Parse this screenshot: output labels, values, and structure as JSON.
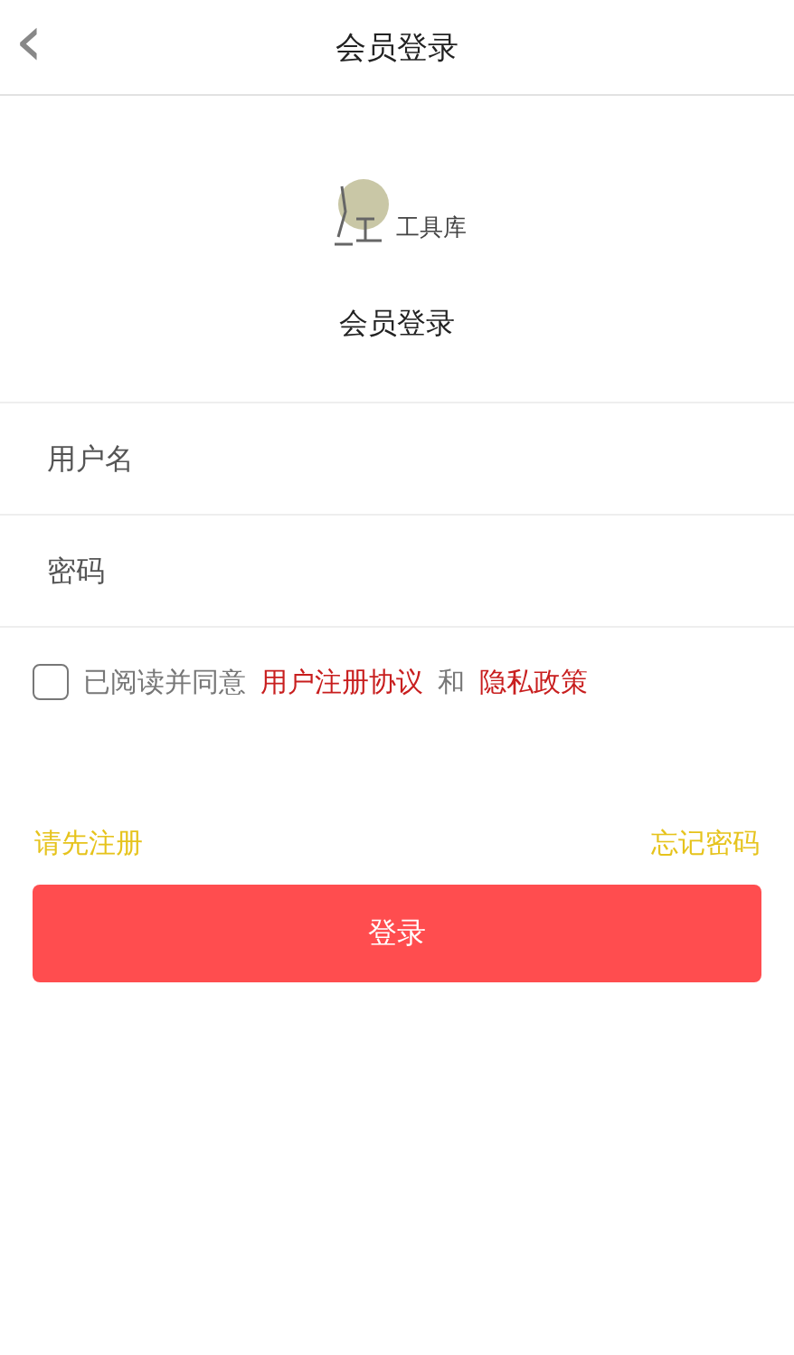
{
  "header": {
    "back_icon": "‹",
    "title": "会员登录"
  },
  "logo": {
    "text": "工具库"
  },
  "subtitle": "会员登录",
  "fields": [
    {
      "placeholder": "用户名"
    },
    {
      "placeholder": "密码"
    }
  ],
  "agreement": {
    "checked": false,
    "prefix": "已阅读并同意",
    "link_1": "用户注册协议",
    "joiner": "和",
    "link_2": "隐私政策"
  },
  "register_link": "请先注册",
  "forgot_link": "忘记密码",
  "login_button": "登录"
}
